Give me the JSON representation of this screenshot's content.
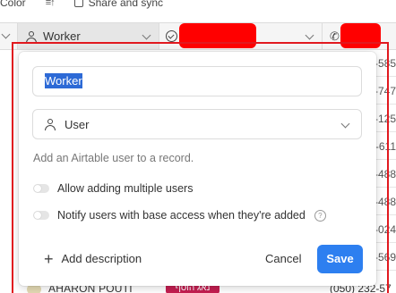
{
  "toolbar": {
    "color_label": "Color",
    "share_label": "Share and sync"
  },
  "columns": {
    "worker_label": "Worker"
  },
  "background_cells": [
    "-585",
    "-747",
    "-125",
    "-611",
    "-488",
    "-488",
    "-024",
    "-569"
  ],
  "bottom_row": {
    "name": "AHARON POUTI",
    "tag": "נאג הוסף",
    "phone": "(050) 232-57"
  },
  "dialog": {
    "field_name": "Worker",
    "field_type": "User",
    "help_text": "Add an Airtable user to a record.",
    "toggle_multiple": "Allow adding multiple users",
    "toggle_notify": "Notify users with base access when they're added",
    "add_description": "Add description",
    "cancel": "Cancel",
    "save": "Save",
    "save_color": "#2d7ff0"
  },
  "annotation_color": "#e1191f",
  "redaction_color": "#ff0000"
}
